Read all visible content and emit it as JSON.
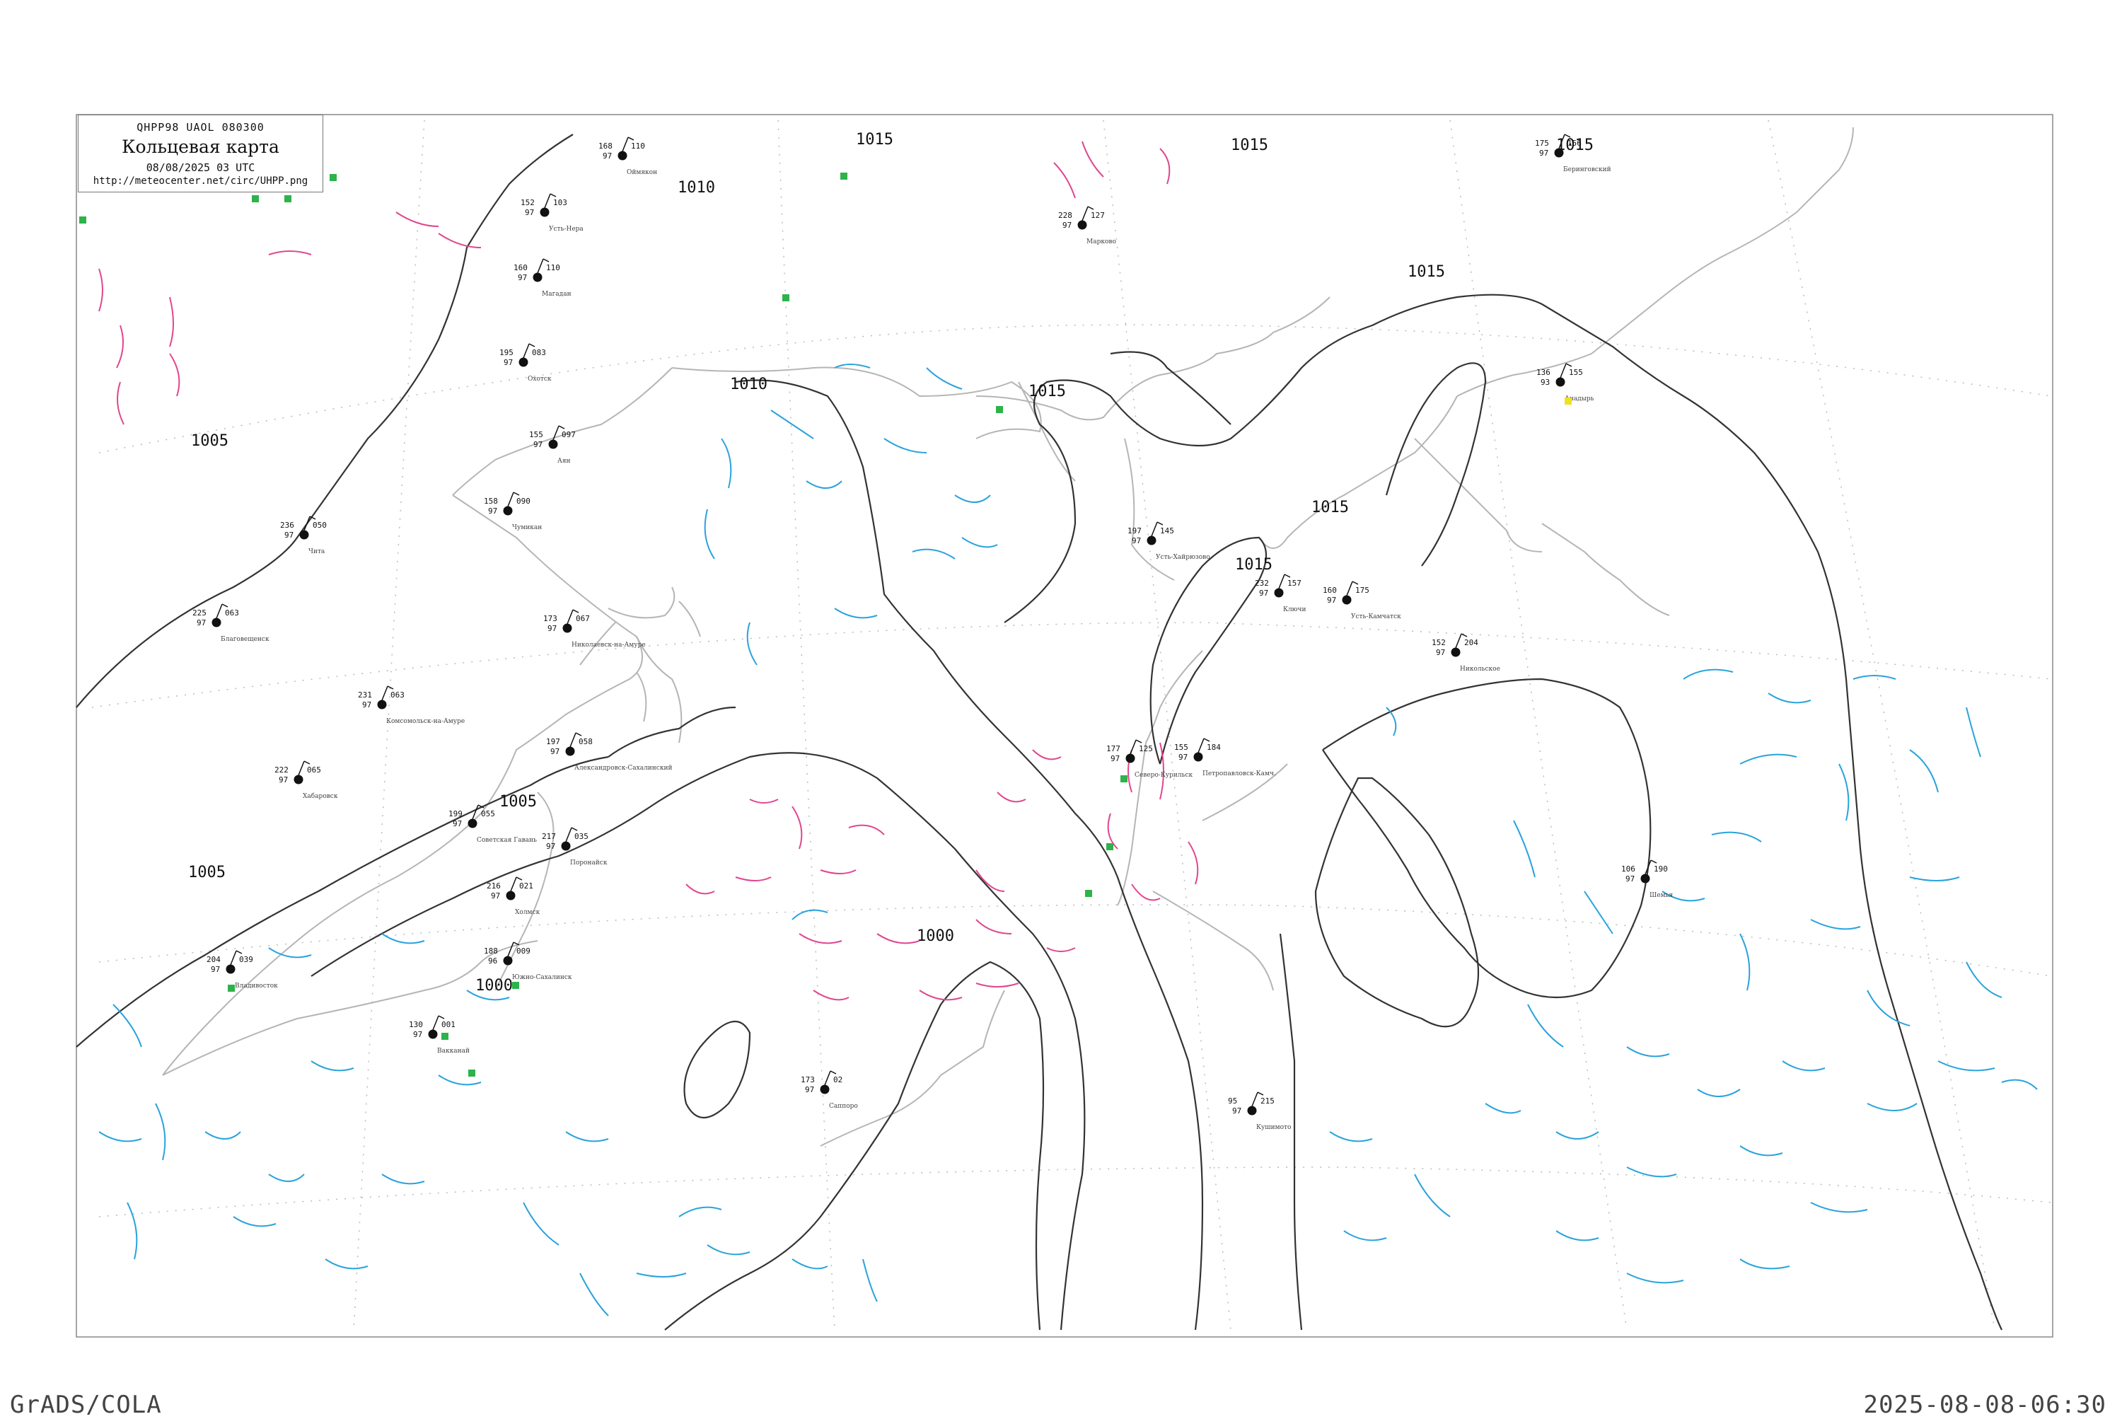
{
  "legend": {
    "code": "QHPP98  UAOL  080300",
    "title": "Кольцевая карта",
    "time": "08/08/2025 03 UTC",
    "url": "http://meteocenter.net/circ/UHPP.png"
  },
  "footer": {
    "left": "GrADS/COLA",
    "right": "2025-08-08-06:30"
  },
  "colors": {
    "isobar": "#333333",
    "coast": "#b5b5b5",
    "blue_isallobar": "#29a3dc",
    "pink_isallobar": "#e0468e",
    "station_text": "#111111",
    "station_name": "#555555",
    "green_marker": "#2db34a",
    "yellow_marker": "#f0e020"
  },
  "isobar_labels": [
    "1015",
    "1010",
    "1010",
    "1010",
    "1015",
    "1015",
    "1015",
    "1015",
    "1015",
    "1005",
    "1005",
    "1005",
    "1000",
    "1000",
    "1015"
  ],
  "stations": [
    {
      "name": "Оймякон",
      "temp": "168",
      "dew": "97",
      "press": "110"
    },
    {
      "name": "Усть-Нера",
      "temp": "152",
      "dew": "97",
      "press": "103"
    },
    {
      "name": "Магадан",
      "temp": "160",
      "dew": "97",
      "press": "110"
    },
    {
      "name": "Охотск",
      "temp": "195",
      "dew": "97",
      "press": "083"
    },
    {
      "name": "Аян",
      "temp": "155",
      "dew": "97",
      "press": "097"
    },
    {
      "name": "Чумикан",
      "temp": "158",
      "dew": "97",
      "press": "090"
    },
    {
      "name": "Николаевск-на-Амуре",
      "temp": "173",
      "dew": "97",
      "press": "067"
    },
    {
      "name": "Комсомольск-на-Амуре",
      "temp": "231",
      "dew": "97",
      "press": "063"
    },
    {
      "name": "Хабаровск",
      "temp": "222",
      "dew": "97",
      "press": "065"
    },
    {
      "name": "Советская Гавань",
      "temp": "199",
      "dew": "97",
      "press": "055"
    },
    {
      "name": "Александровск-Сахалинский",
      "temp": "197",
      "dew": "97",
      "press": "058"
    },
    {
      "name": "Поронайск",
      "temp": "217",
      "dew": "97",
      "press": "035"
    },
    {
      "name": "Холмск",
      "temp": "216",
      "dew": "97",
      "press": "021"
    },
    {
      "name": "Южно-Сахалинск",
      "temp": "188",
      "dew": "96",
      "press": "009"
    },
    {
      "name": "Владивосток",
      "temp": "204",
      "dew": "97",
      "press": "039"
    },
    {
      "name": "Северо-Курильск",
      "temp": "177",
      "dew": "97",
      "press": "125"
    },
    {
      "name": "Петропавловск-Камч.",
      "temp": "155",
      "dew": "97",
      "press": "184"
    },
    {
      "name": "Усть-Камчатск",
      "temp": "160",
      "dew": "97",
      "press": "175"
    },
    {
      "name": "Ключи",
      "temp": "232",
      "dew": "97",
      "press": "157"
    },
    {
      "name": "Усть-Хайрюзово",
      "temp": "197",
      "dew": "97",
      "press": "145"
    },
    {
      "name": "Анадырь",
      "temp": "136",
      "dew": "93",
      "press": "155"
    },
    {
      "name": "Беринговский",
      "temp": "175",
      "dew": "97",
      "press": "156"
    },
    {
      "name": "Марково",
      "temp": "228",
      "dew": "97",
      "press": "127"
    },
    {
      "name": "Никольское",
      "temp": "152",
      "dew": "97",
      "press": "204"
    },
    {
      "name": "Шемья",
      "temp": "106",
      "dew": "97",
      "press": "190"
    },
    {
      "name": "Саппоро",
      "temp": "173",
      "dew": "97",
      "press": "02"
    },
    {
      "name": "Вакканай",
      "temp": "130",
      "dew": "97",
      "press": "001"
    },
    {
      "name": "Кушимото",
      "temp": "95",
      "dew": "97",
      "press": "215"
    },
    {
      "name": "Чита",
      "temp": "236",
      "dew": "97",
      "press": "050"
    },
    {
      "name": "Благовещенск",
      "temp": "225",
      "dew": "97",
      "press": "063"
    }
  ]
}
